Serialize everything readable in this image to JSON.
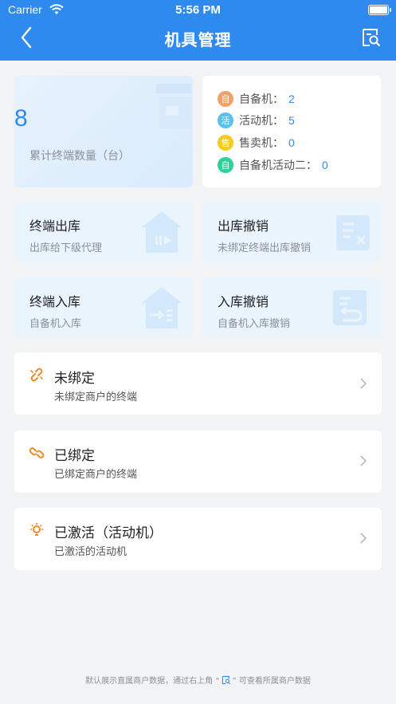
{
  "status_bar": {
    "carrier": "Carrier",
    "time": "5:56 PM"
  },
  "nav": {
    "title": "机具管理",
    "back_icon": "chevron-left-icon",
    "search_icon": "document-search-icon"
  },
  "summary": {
    "count": "8",
    "label": "累计终端数量（台）"
  },
  "types": [
    {
      "badge": "自",
      "label": "自备机：",
      "value": "2",
      "color": "#f5a06b"
    },
    {
      "badge": "活",
      "label": "活动机：",
      "value": "5",
      "color": "#5bc0f0"
    },
    {
      "badge": "售",
      "label": "售卖机：",
      "value": "0",
      "color": "#f5cc1b"
    },
    {
      "badge": "自",
      "label": "自备机活动二：",
      "value": "0",
      "color": "#2bd29a"
    }
  ],
  "tiles": [
    {
      "title": "终端出库",
      "subtitle": "出库给下级代理",
      "icon": "warehouse-out-icon"
    },
    {
      "title": "出库撤销",
      "subtitle": "未绑定终端出库撤销",
      "icon": "cancel-list-icon"
    },
    {
      "title": "终端入库",
      "subtitle": "自备机入库",
      "icon": "warehouse-in-icon"
    },
    {
      "title": "入库撤销",
      "subtitle": "自备机入库撤销",
      "icon": "undo-list-icon"
    }
  ],
  "rows": [
    {
      "title": "未绑定",
      "subtitle": "未绑定商户的终端",
      "icon": "unlink-icon"
    },
    {
      "title": "已绑定",
      "subtitle": "已绑定商户的终端",
      "icon": "link-icon"
    },
    {
      "title": "已激活（活动机）",
      "subtitle": "已激活的活动机",
      "icon": "lightbulb-icon"
    }
  ],
  "footer": {
    "text_before": "默认展示直属商户数据，通过右上角 “",
    "text_after": "” 可查看所属商户数据"
  },
  "colors": {
    "primary": "#2f8af0",
    "orange": "#f08a24",
    "tile_bg": "#e9f4fd"
  }
}
